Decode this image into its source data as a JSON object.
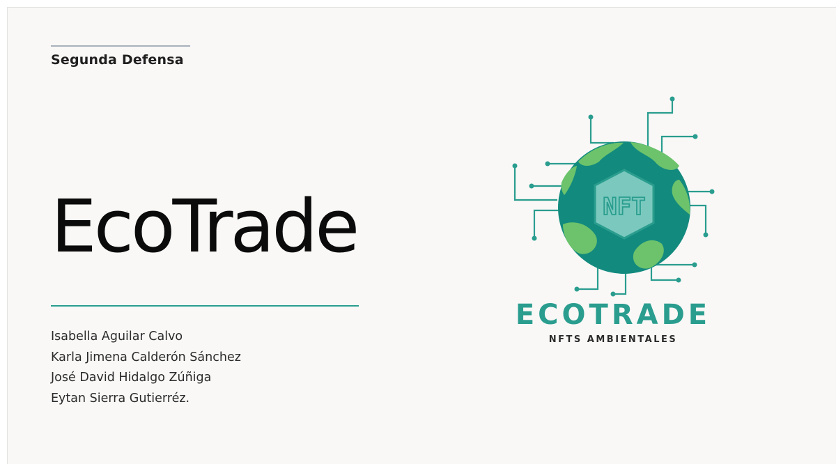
{
  "slide": {
    "subtitle": "Segunda Defensa",
    "title": "EcoTrade",
    "authors": [
      "Isabella Aguilar Calvo",
      "Karla Jimena Calderón Sánchez",
      "José David Hidalgo Zúñiga",
      "Eytan Sierra Gutierréz."
    ]
  },
  "logo": {
    "badge_text": "NFT",
    "brand_name": "ECOTRADE",
    "tagline": "NFTS AMBIENTALES",
    "colors": {
      "teal": "#2a9d8f",
      "ocean": "#138a7e",
      "land": "#6cc36b",
      "circuit": "#2a9d8f"
    }
  }
}
